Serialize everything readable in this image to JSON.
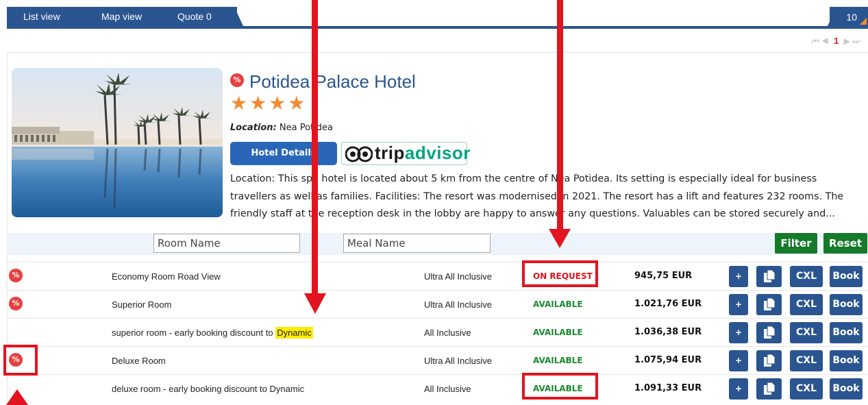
{
  "tabs": [
    {
      "label": "List view"
    },
    {
      "label": "Map view"
    },
    {
      "label": "Quote 0"
    }
  ],
  "results_count": "10",
  "pager": {
    "first": "⏮",
    "prev": "◀",
    "current": "1",
    "next": "▶",
    "last": "⏭"
  },
  "hotel": {
    "badge": "%",
    "name": "Potidea Palace Hotel",
    "stars": 4,
    "stars_text": "★★★★",
    "location_label": "Location:",
    "location_value": "Nea Potidea",
    "details_button": "Hotel Details",
    "tripadvisor_trip": "trip",
    "tripadvisor_advisor": "advisor",
    "description": "Location: This spa hotel is located about 5 km from the centre of Nea Potidea. Its setting is especially ideal for business travellers as well as families. Facilities: The resort was modernised in 2021. The resort has a lift and features 232 rooms. The friendly staff at the reception desk in the lobby are happy to answer any questions. Valuables can be stored securely and..."
  },
  "filters": {
    "room_placeholder": "Room Name",
    "meal_placeholder": "Meal Name",
    "filter_label": "Filter",
    "reset_label": "Reset"
  },
  "rooms": [
    {
      "discount": true,
      "badge": "%",
      "name": "Economy Room Road View",
      "meal": "Ultra All Inclusive",
      "status": "ON REQUEST",
      "price": "945,75 EUR"
    },
    {
      "discount": true,
      "badge": "%",
      "name": "Superior Room",
      "meal": "Ultra All Inclusive",
      "status": "AVAILABLE",
      "price": "1.021,76 EUR"
    },
    {
      "discount": false,
      "name_prefix": "superior room - early booking discount to ",
      "name_highlight": "Dynamic",
      "meal": "All Inclusive",
      "status": "AVAILABLE",
      "price": "1.036,38 EUR"
    },
    {
      "discount": true,
      "badge": "%",
      "name": "Deluxe Room",
      "meal": "Ultra All Inclusive",
      "status": "AVAILABLE",
      "price": "1.075,94 EUR"
    },
    {
      "discount": false,
      "name": "deluxe room - early booking discount to Dynamic",
      "meal": "All Inclusive",
      "status": "AVAILABLE",
      "price": "1.091,33 EUR"
    }
  ],
  "row_buttons": {
    "plus": "+",
    "cxl": "CXL",
    "book": "Book"
  },
  "colors": {
    "brand_blue": "#2a5590",
    "green": "#157a29",
    "red": "#e2141f",
    "star": "#f28a30",
    "tripadvisor_green": "#00a680",
    "highlight": "#ffec00"
  },
  "icons": {
    "discount": "percent-badge-icon",
    "copy": "copy-icon",
    "owl": "tripadvisor-owl-icon"
  }
}
